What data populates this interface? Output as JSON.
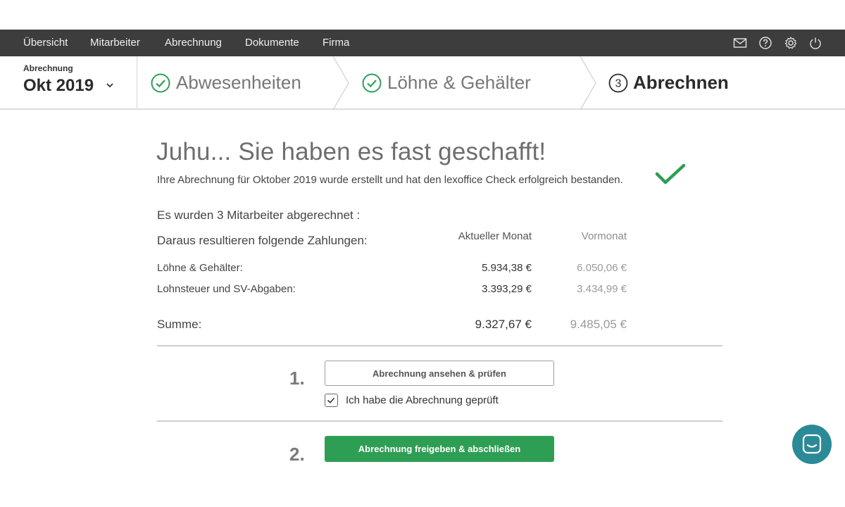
{
  "nav": {
    "items": [
      {
        "label": "Übersicht"
      },
      {
        "label": "Mitarbeiter"
      },
      {
        "label": "Abrechnung"
      },
      {
        "label": "Dokumente"
      },
      {
        "label": "Firma"
      }
    ],
    "icons": [
      "mail-icon",
      "help-icon",
      "gear-icon",
      "power-icon"
    ]
  },
  "stepper": {
    "period_label": "Abrechnung",
    "period_value": "Okt 2019",
    "steps": [
      {
        "label": "Abwesenheiten",
        "state": "done"
      },
      {
        "label": "Löhne & Gehälter",
        "state": "done"
      },
      {
        "number": "3",
        "label": "Abrechnen",
        "state": "active"
      }
    ]
  },
  "main": {
    "headline": "Juhu... Sie haben es fast geschafft!",
    "subline": "Ihre Abrechnung für Oktober 2019 wurde erstellt und hat den lexoffice Check erfolgreich bestanden.",
    "employees_text": "Es wurden 3 Mitarbeiter abgerechnet :",
    "payments_text": "Daraus resultieren folgende Zahlungen:",
    "columns": {
      "current": "Aktueller Monat",
      "previous": "Vormonat"
    },
    "rows": [
      {
        "label": "Löhne & Gehälter:",
        "current": "5.934,38 €",
        "previous": "6.050,06 €"
      },
      {
        "label": "Lohnsteuer und SV-Abgaben:",
        "current": "3.393,29 €",
        "previous": "3.434,99 €"
      }
    ],
    "sum": {
      "label": "Summe:",
      "current": "9.327,67 €",
      "previous": "9.485,05 €"
    }
  },
  "actions": {
    "step1_number": "1.",
    "review_button": "Abrechnung ansehen & prüfen",
    "checkbox_label": "Ich habe die Abrechnung geprüft",
    "checkbox_checked": true,
    "step2_number": "2.",
    "finalize_button": "Abrechnung freigeben & abschließen"
  },
  "colors": {
    "nav_bg": "#3d3d3d",
    "accent_green": "#2f9e55",
    "chat_teal": "#2b8a97"
  }
}
